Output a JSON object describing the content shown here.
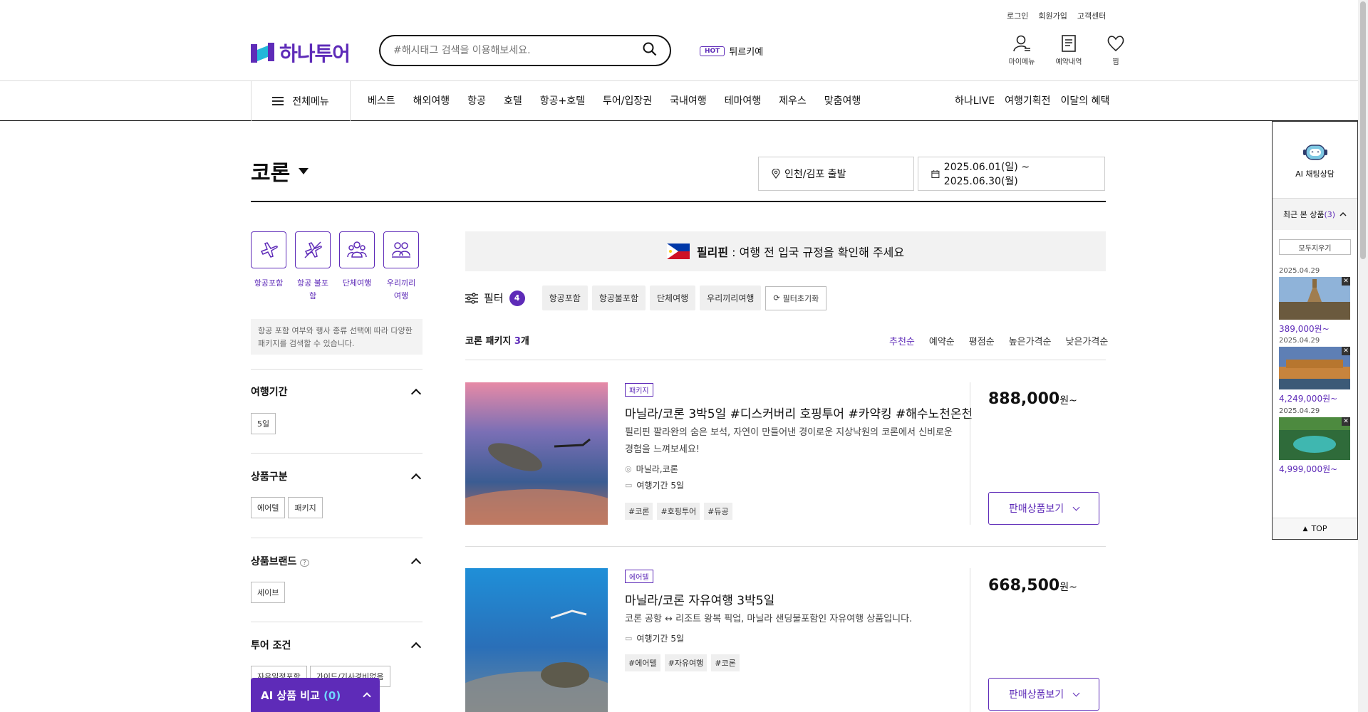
{
  "util_links": [
    "로그인",
    "회원가입",
    "고객센터"
  ],
  "brand": {
    "name": "하나투어",
    "color": "#5e2bb8"
  },
  "search": {
    "placeholder": "#해시태그 검색을 이용해보세요."
  },
  "hot": {
    "badge": "HOT",
    "keyword": "튀르키예"
  },
  "header_icons": [
    {
      "label": "마이메뉴",
      "icon": "person-menu-icon"
    },
    {
      "label": "예약내역",
      "icon": "document-icon"
    },
    {
      "label": "찜",
      "icon": "heart-icon"
    }
  ],
  "gnb": {
    "all_menu": "전체메뉴",
    "items": [
      "베스트",
      "해외여행",
      "항공",
      "호텔",
      "항공+호텔",
      "투어/입장권",
      "국내여행",
      "테마여행",
      "제우스",
      "맞춤여행"
    ],
    "right": [
      "하나LIVE",
      "여행기획전",
      "이달의 혜택"
    ]
  },
  "destination": "코론",
  "departure": "인천/김포 출발",
  "date_range": "2025.06.01(일) ~ 2025.06.30(월)",
  "categories": [
    {
      "label": "항공포함",
      "icon": "airplane-icon"
    },
    {
      "label": "항공 불포함",
      "icon": "no-airplane-icon"
    },
    {
      "label": "단체여행",
      "icon": "group-icon"
    },
    {
      "label": "우리끼리 여행",
      "icon": "private-group-icon"
    }
  ],
  "side_note": "항공 포함 여부와 행사 종류 선택에 따라 다양한 패키지를 검색할 수 있습니다.",
  "filter_sections": [
    {
      "title": "여행기간",
      "options": [
        "5일"
      ]
    },
    {
      "title": "상품구분",
      "options": [
        "에어텔",
        "패키지"
      ]
    },
    {
      "title": "상품브랜드",
      "options": [
        "세이브"
      ],
      "help": "?"
    },
    {
      "title": "투어 조건",
      "options": [
        "자유일정포함",
        "가이드/기사경비없음"
      ]
    }
  ],
  "notice": {
    "country": "필리핀",
    "text": " : 여행 전 입국 규정을 확인해 주세요"
  },
  "filter": {
    "label": "필터",
    "count": "4",
    "chips": [
      "항공포함",
      "항공불포함",
      "단체여행",
      "우리끼리여행"
    ],
    "reset": "필터초기화"
  },
  "result": {
    "prefix": "코론 패키지 ",
    "count": "3",
    "suffix": "개"
  },
  "sorts": [
    "추천순",
    "예약순",
    "평점순",
    "높은가격순",
    "낮은가격순"
  ],
  "products": [
    {
      "tag": "패키지",
      "title": "마닐라/코론 3박5일 #디스커버리 호핑투어 #카약킹 #해수노천온천",
      "desc": "필리핀 팔라완의 숨은 보석, 자연이 만들어낸 경이로운 지상낙원의 코론에서 신비로운 경험을 느껴보세요!",
      "location": "마닐라,코론",
      "duration": "여행기간 5일",
      "hashtags": [
        "#코론",
        "#호핑투어",
        "#듀공"
      ],
      "price": "888,000",
      "unit": "원~",
      "button": "판매상품보기"
    },
    {
      "tag": "에어텔",
      "title": "마닐라/코론 자유여행 3박5일",
      "desc": "코론 공항 ↔ 리조트 왕복 픽업, 마닐라 샌딩불포함인 자유여행 상품입니다.",
      "duration": "여행기간 5일",
      "hashtags": [
        "#에어텔",
        "#자유여행",
        "#코론"
      ],
      "price": "668,500",
      "unit": "원~",
      "button": "판매상품보기"
    }
  ],
  "rail": {
    "ai_label": "AI 채팅상담",
    "recent_label": "최근 본 상품",
    "recent_count": "(3)",
    "clear": "모두지우기",
    "items": [
      {
        "date": "2025.04.29",
        "price": "389,000원~"
      },
      {
        "date": "2025.04.29",
        "price": "4,249,000원~"
      },
      {
        "date": "2025.04.29",
        "price": "4,999,000원~"
      }
    ],
    "top": "TOP"
  },
  "compare": {
    "label": "AI 상품 비교 ",
    "count": "(0)"
  }
}
